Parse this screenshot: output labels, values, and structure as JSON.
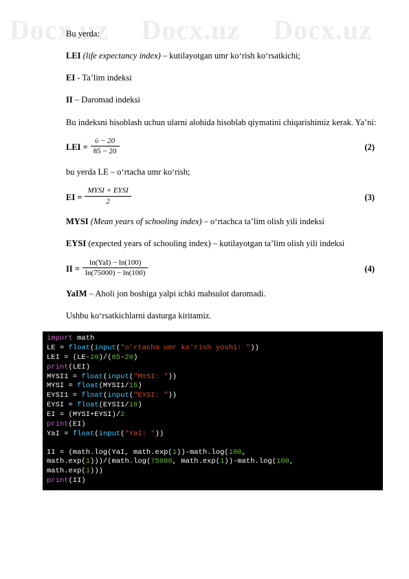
{
  "watermark": {
    "text": "Docx.uz",
    "repeat": 3
  },
  "body": {
    "p1": "Bu yerda:",
    "p2_bold": "LEI",
    "p2_italic": "(life expectancy index)",
    "p2_rest": " – kutilayotgan umr ko‘rish ko‘rsatkichi;",
    "p3_bold": "EI",
    "p3_rest": " -  Ta’lim indeksi",
    "p4_bold": "II",
    "p4_rest": " – Daromad indeksi",
    "p5": "Bu indeksni hisoblash uchun ularni alohida hisoblab qiymatini chiqarishimiz kerak. Ya’ni:",
    "f1_lhs": "LEI =",
    "f1_num": "ὺ − 20",
    "f1_den": "85 − 20",
    "f1_eqnum": "(2)",
    "p6": "bu yerda LE  – o‘rtacha umr ko‘rish;",
    "f2_lhs": "EI =",
    "f2_num": "MYSI + EYSI",
    "f2_den": "2",
    "f2_eqnum": "(3)",
    "p7_bold": "MYSI",
    "p7_italic": "(Mean years of schooling index)",
    "p7_rest": " – o‘rtachca ta’lim olish yili indeksi",
    "p8_bold": "EYSI",
    "p8_rest": " (expected years of schooling index) – kutilayotgan ta’lim olish yili indeksi",
    "f3_lhs": "II =",
    "f3_num": "ln(YaI) − ln(100)",
    "f3_den": "ln(75000) − ln(100)",
    "f3_eqnum": "(4)",
    "p9_bold": "YaIM",
    "p9_rest": " – Aholi jon boshiga yalpi ichki mahsulot daromadi.",
    "p10": "Ushbu ko‘rsatkichlarni dasturga kiritamiz."
  },
  "code": {
    "lines": [
      [
        {
          "t": "import",
          "c": "kw"
        },
        {
          "t": " math",
          "c": "pl"
        }
      ],
      [
        {
          "t": "LE = ",
          "c": "pl"
        },
        {
          "t": "float",
          "c": "fn"
        },
        {
          "t": "(",
          "c": "pl"
        },
        {
          "t": "input",
          "c": "fn"
        },
        {
          "t": "(",
          "c": "pl"
        },
        {
          "t": "\"o'rtacha umr ko'rish yoshi: \"",
          "c": "str"
        },
        {
          "t": "))",
          "c": "pl"
        }
      ],
      [
        {
          "t": "LEI = (LE-",
          "c": "pl"
        },
        {
          "t": "20",
          "c": "num2"
        },
        {
          "t": ")/(",
          "c": "pl"
        },
        {
          "t": "85",
          "c": "num2"
        },
        {
          "t": "-",
          "c": "pl"
        },
        {
          "t": "20",
          "c": "num2"
        },
        {
          "t": ")",
          "c": "pl"
        }
      ],
      [
        {
          "t": "print",
          "c": "kw"
        },
        {
          "t": "(LEI)",
          "c": "pl"
        }
      ],
      [
        {
          "t": "MYSI1 = ",
          "c": "pl"
        },
        {
          "t": "float",
          "c": "fn"
        },
        {
          "t": "(",
          "c": "pl"
        },
        {
          "t": "input",
          "c": "fn"
        },
        {
          "t": "(",
          "c": "pl"
        },
        {
          "t": "\"MYSI: \"",
          "c": "str"
        },
        {
          "t": "))",
          "c": "pl"
        }
      ],
      [
        {
          "t": "MYSI = ",
          "c": "pl"
        },
        {
          "t": "float",
          "c": "fn"
        },
        {
          "t": "(MYSI1/",
          "c": "pl"
        },
        {
          "t": "15",
          "c": "num2"
        },
        {
          "t": ")",
          "c": "pl"
        }
      ],
      [
        {
          "t": "EYSI1 = ",
          "c": "pl"
        },
        {
          "t": "float",
          "c": "fn"
        },
        {
          "t": "(",
          "c": "pl"
        },
        {
          "t": "input",
          "c": "fn"
        },
        {
          "t": "(",
          "c": "pl"
        },
        {
          "t": "\"EYSI: \"",
          "c": "str"
        },
        {
          "t": "))",
          "c": "pl"
        }
      ],
      [
        {
          "t": "EYSI = ",
          "c": "pl"
        },
        {
          "t": "float",
          "c": "fn"
        },
        {
          "t": "(EYSI1/",
          "c": "pl"
        },
        {
          "t": "18",
          "c": "num2"
        },
        {
          "t": ")",
          "c": "pl"
        }
      ],
      [
        {
          "t": "EI = (MYSI+EYSI)/",
          "c": "pl"
        },
        {
          "t": "2",
          "c": "num2"
        }
      ],
      [
        {
          "t": "print",
          "c": "kw"
        },
        {
          "t": "(EI)",
          "c": "pl"
        }
      ],
      [
        {
          "t": "YaI = ",
          "c": "pl"
        },
        {
          "t": "float",
          "c": "fn"
        },
        {
          "t": "(",
          "c": "pl"
        },
        {
          "t": "input",
          "c": "fn"
        },
        {
          "t": "(",
          "c": "pl"
        },
        {
          "t": "\"YaI: \"",
          "c": "str"
        },
        {
          "t": "))",
          "c": "pl"
        }
      ],
      [
        {
          "t": "",
          "c": "pl"
        }
      ],
      [
        {
          "t": "II = (math.log(YaI, math.exp(",
          "c": "pl"
        },
        {
          "t": "1",
          "c": "num2"
        },
        {
          "t": "))-math.log(",
          "c": "pl"
        },
        {
          "t": "100",
          "c": "num2"
        },
        {
          "t": ",",
          "c": "pl"
        }
      ],
      [
        {
          "t": "math.exp(",
          "c": "pl"
        },
        {
          "t": "1",
          "c": "num2"
        },
        {
          "t": ")))/(math.log(",
          "c": "pl"
        },
        {
          "t": "75000",
          "c": "num2"
        },
        {
          "t": ", math.exp(",
          "c": "pl"
        },
        {
          "t": "1",
          "c": "num2"
        },
        {
          "t": "))-math.log(",
          "c": "pl"
        },
        {
          "t": "100",
          "c": "num2"
        },
        {
          "t": ",",
          "c": "pl"
        }
      ],
      [
        {
          "t": "math.exp(",
          "c": "pl"
        },
        {
          "t": "1",
          "c": "num2"
        },
        {
          "t": ")))",
          "c": "pl"
        }
      ],
      [
        {
          "t": "print",
          "c": "kw"
        },
        {
          "t": "(II)",
          "c": "pl"
        }
      ]
    ]
  },
  "colors": {
    "code_bg": "#000000",
    "keyword": "#cc66cc",
    "function": "#4ec9ff",
    "string": "#d04f28",
    "number": "#6bbf3a",
    "watermark": "#eceded"
  }
}
